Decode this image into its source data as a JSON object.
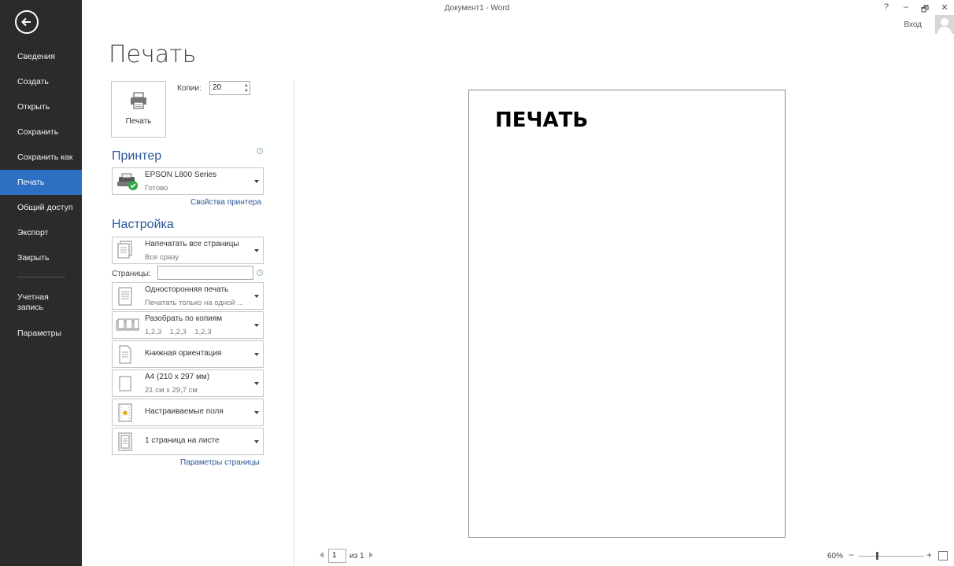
{
  "window": {
    "title": "Документ1 - Word",
    "help": "?",
    "minimize": "–",
    "restore": "🗗",
    "close": "✕",
    "login": "Вход"
  },
  "sidebar": {
    "items": [
      {
        "label": "Сведения"
      },
      {
        "label": "Создать"
      },
      {
        "label": "Открыть"
      },
      {
        "label": "Сохранить"
      },
      {
        "label": "Сохранить как"
      },
      {
        "label": "Печать",
        "active": true
      },
      {
        "label": "Общий доступ"
      },
      {
        "label": "Экспорт"
      },
      {
        "label": "Закрыть"
      }
    ],
    "account_line1": "Учетная",
    "account_line2": "запись",
    "options": "Параметры"
  },
  "print": {
    "title": "Печать",
    "button_label": "Печать",
    "copies_label": "Копии:",
    "copies_value": "20"
  },
  "printer": {
    "heading": "Принтер",
    "name": "EPSON L800 Series",
    "status": "Готово",
    "properties_link": "Свойства принтера"
  },
  "settings": {
    "heading": "Настройка",
    "pages_label": "Страницы:",
    "page_setup_link": "Параметры страницы",
    "items": [
      {
        "line1": "Напечатать все страницы",
        "line2": "Все сразу"
      },
      {
        "line1": "Односторонняя печать",
        "line2": "Печатать только на одной ..."
      },
      {
        "line1": "Разобрать по копиям",
        "line2": "1,2,3    1,2,3    1,2,3"
      },
      {
        "line1": "Книжная ориентация",
        "line2": ""
      },
      {
        "line1": "А4 (210 x 297 мм)",
        "line2": "21 см x 29,7 см"
      },
      {
        "line1": "Настраиваемые поля",
        "line2": ""
      },
      {
        "line1": "1 страница на листе",
        "line2": ""
      }
    ]
  },
  "preview": {
    "text": "ПЕЧАТЬ",
    "current_page": "1",
    "of_pages": "из 1",
    "zoom": "60%",
    "zoom_minus": "−",
    "zoom_plus": "+",
    "zoom_level": 0.29
  },
  "colors": {
    "sidebar_bg": "#2b2b2b",
    "active_bg": "#2d6fc2",
    "heading": "#2b579a"
  }
}
